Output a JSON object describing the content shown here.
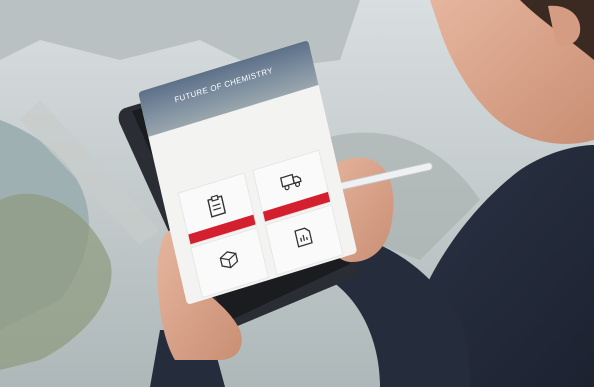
{
  "screen": {
    "hero_title": "FUTURE OF CHEMISTRY",
    "tabs": [
      "",
      "",
      ""
    ],
    "lines": [
      "",
      ""
    ],
    "link": "",
    "tiles": [
      {
        "icon": "clipboard-icon",
        "button": ""
      },
      {
        "icon": "truck-icon",
        "button": ""
      },
      {
        "icon": "box-icon",
        "button": ""
      },
      {
        "icon": "document-chart-icon",
        "button": ""
      }
    ]
  },
  "colors": {
    "accent": "#d41f2e",
    "hero": "#6f8194"
  }
}
